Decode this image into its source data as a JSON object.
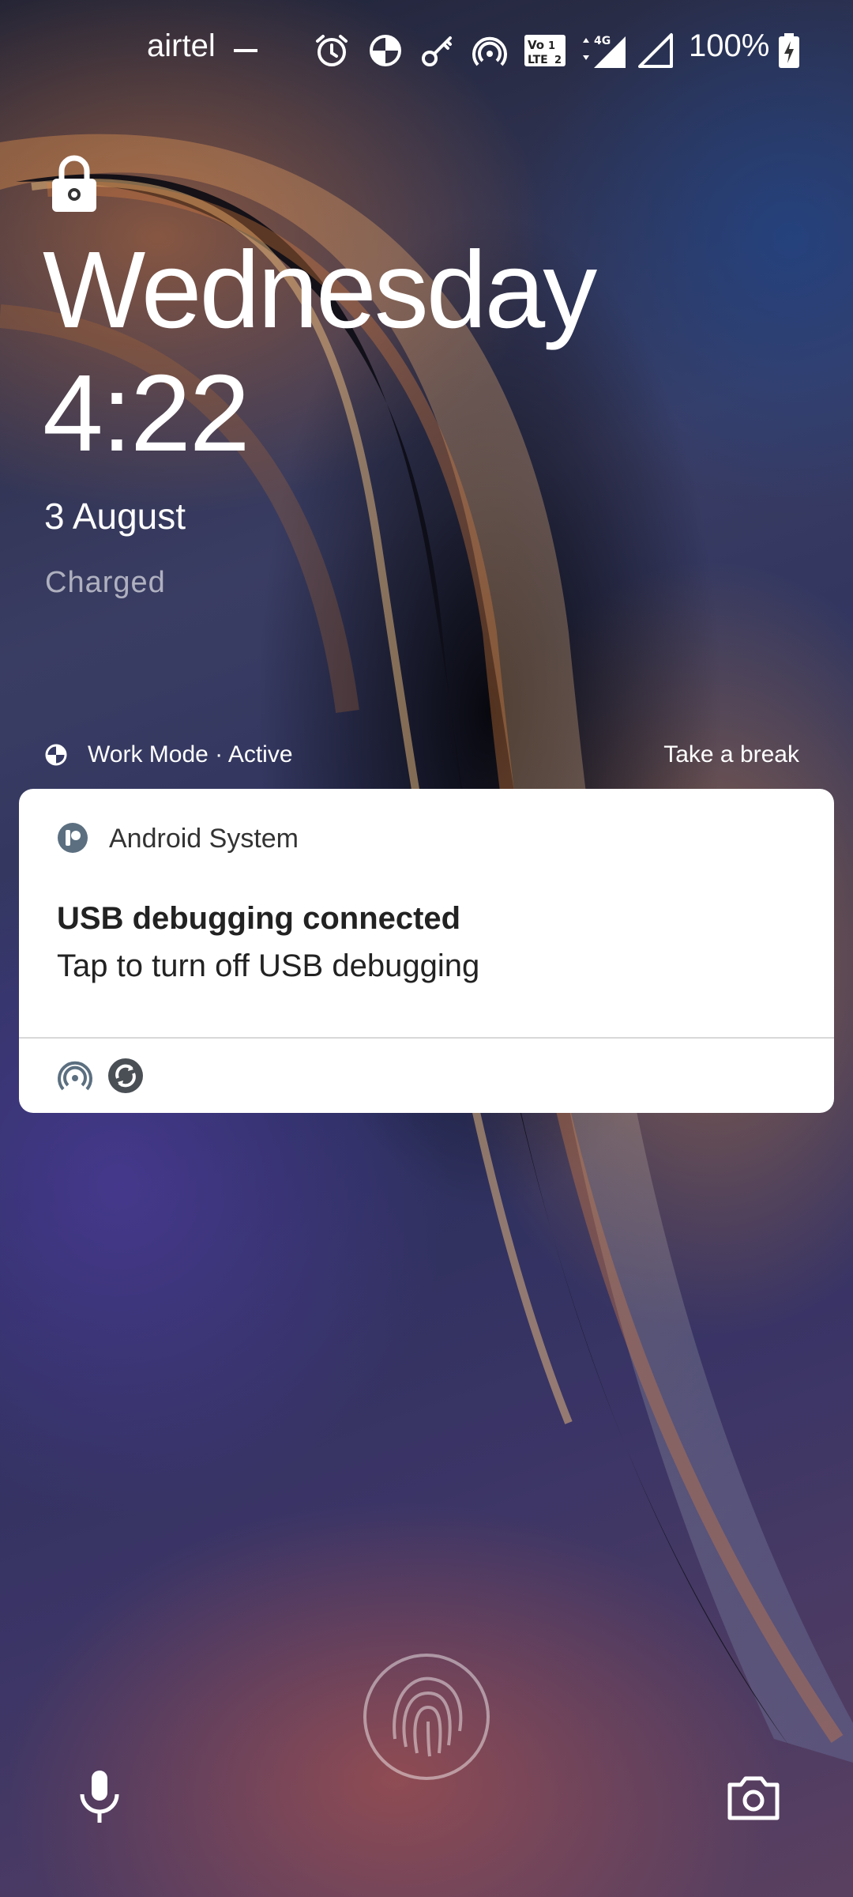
{
  "status_bar": {
    "carrier": "airtel",
    "battery_percent": "100%",
    "icons": [
      "alarm-icon",
      "work-mode-icon",
      "vpn-key-icon",
      "hotspot-icon",
      "volte-icon",
      "signal-4g-icon",
      "signal-icon",
      "battery-charging-icon"
    ],
    "volte_label": "Vo 1 LTE 2",
    "network_label": "4G"
  },
  "lockscreen": {
    "day": "Wednesday",
    "time": "4:22",
    "date": "3 August",
    "charge_status": "Charged",
    "lock_icon": "lock-icon"
  },
  "work_mode": {
    "status": "Work Mode · Active",
    "action": "Take a break"
  },
  "notification": {
    "app_name": "Android System",
    "title": "USB debugging connected",
    "text": "Tap to turn off USB debugging",
    "footer_icons": [
      "hotspot-icon",
      "sync-icon"
    ]
  },
  "bottom": {
    "left_shortcut": "microphone-icon",
    "center": "fingerprint-icon",
    "right_shortcut": "camera-icon"
  },
  "colors": {
    "card_background": "#ffffff",
    "icon_accent": "#5b6f80"
  }
}
